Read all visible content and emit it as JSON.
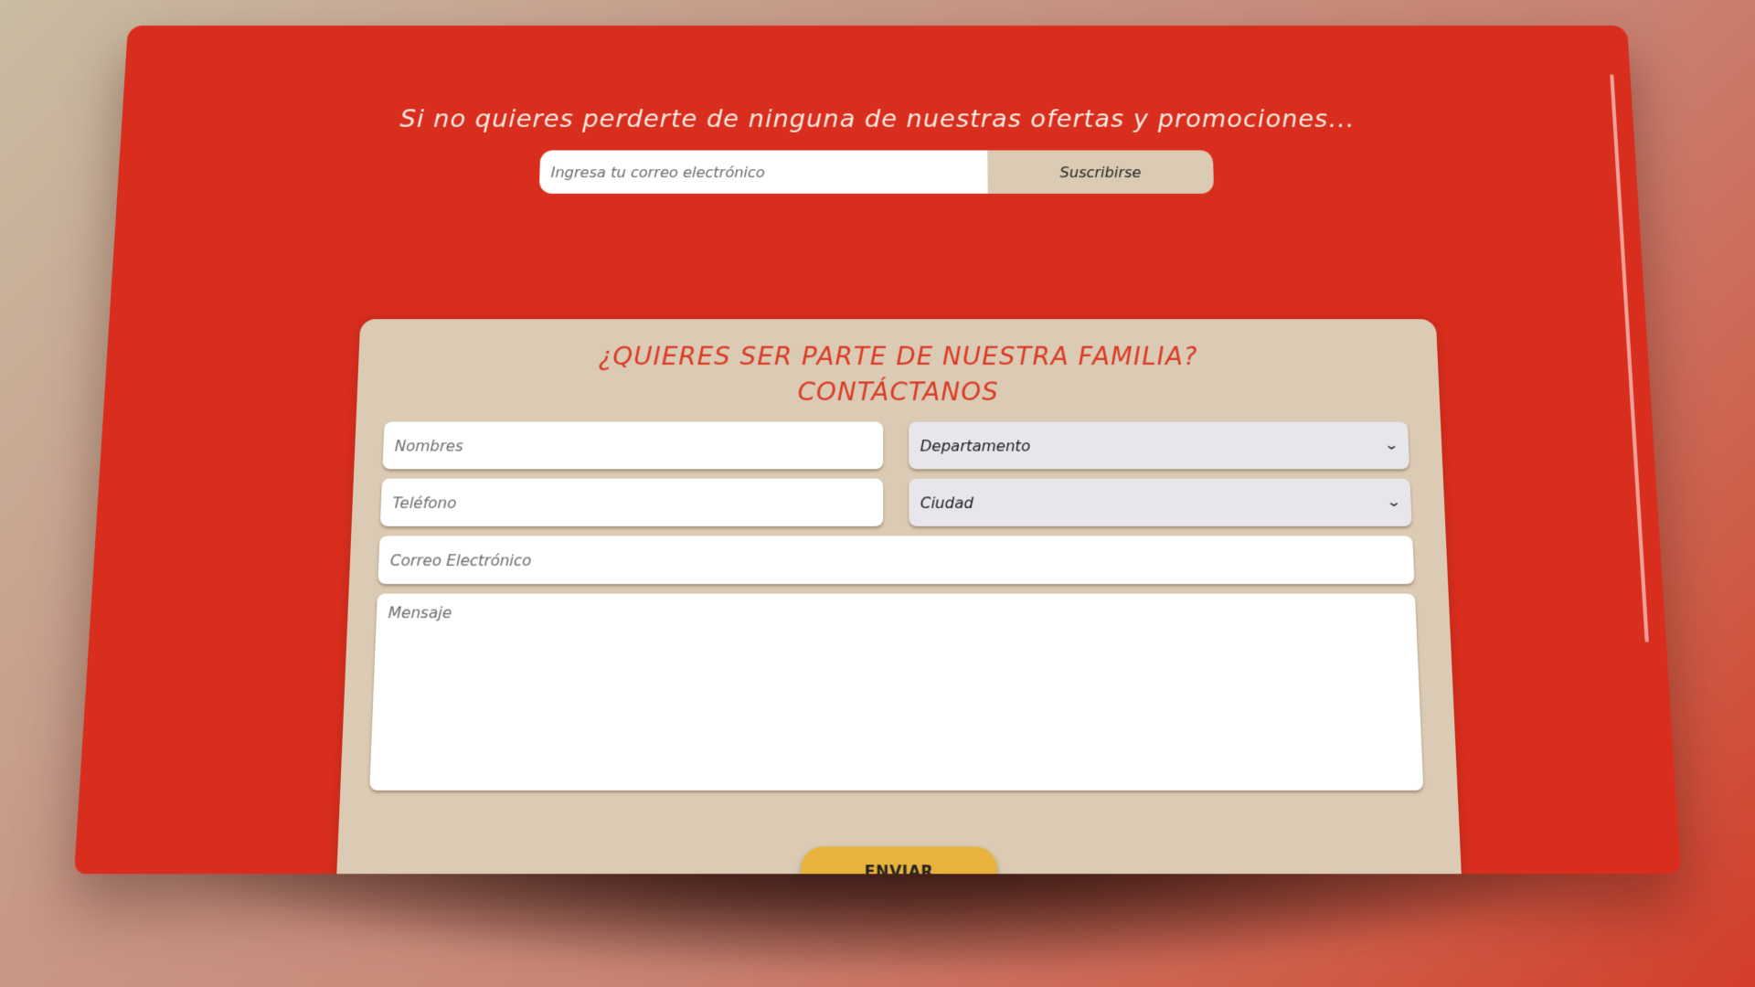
{
  "newsletter": {
    "headline": "Si no quieres perderte de ninguna de nuestras ofertas y promociones...",
    "email_placeholder": "Ingresa tu correo electrónico",
    "subscribe_label": "Suscribirse"
  },
  "contact_form": {
    "title_line1": "¿QUIERES SER PARTE DE NUESTRA FAMILIA?",
    "title_line2": "CONTÁCTANOS",
    "nombres_placeholder": "Nombres",
    "departamento_value": "Departamento",
    "telefono_placeholder": "Teléfono",
    "ciudad_value": "Ciudad",
    "correo_placeholder": "Correo Electrónico",
    "mensaje_placeholder": "Mensaje",
    "submit_label": "ENVIAR"
  },
  "icons": {
    "dropdown_chevron": "chevron-down-icon"
  },
  "colors": {
    "primary_red": "#d92e1e",
    "card_beige": "#dbcbb4",
    "accent_yellow": "#e9b23c",
    "title_red": "#db3a24"
  }
}
